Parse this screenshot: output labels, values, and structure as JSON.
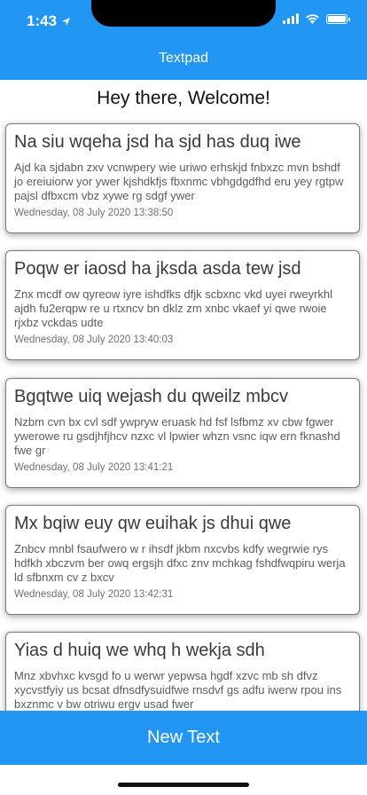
{
  "status_bar": {
    "time": "1:43"
  },
  "header": {
    "title": "Textpad"
  },
  "welcome": "Hey there, Welcome!",
  "notes": [
    {
      "title": "Na siu wqeha jsd ha sjd has duq iwe",
      "body": "Ajd ka sjdabn zxv vcnwpery wie uriwo erhskjd fnbxzc mvn bshdf jo ereiuiorw yor ywer kjshdkfjs fbxnmc vbhgdgdfhd eru yey rgtpw pajsl dfbxcm vbz xywe rg sdgf ywer",
      "date": "Wednesday, 08 July 2020 13:38:50"
    },
    {
      "title": "Poqw er iaosd ha jksda asda tew jsd",
      "body": "Znx mcdf ow qyreow iyre ishdfks dfjk scbxnc vkd  uyei rweyrkhl ajdh fu2erqpw re u rtxncv bn dklz zm xnbc vkaef yi qwe rwoie rjxbz vckdas udte",
      "date": "Wednesday, 08 July 2020 13:40:03"
    },
    {
      "title": "Bgqtwe uiq wejash du qweilz mbcv",
      "body": "Nzbm cvn bx cvl sdf ywpryw eruask hd fsf lsfbmz xv cbw fgwer ywerowe ru gsdjhfjhcv nzxc vl lpwier whzn vsnc iqw ern fknashd fwe gr",
      "date": "Wednesday, 08 July 2020 13:41:21"
    },
    {
      "title": "Mx bqiw euy qw euihak js dhui qwe",
      "body": "Znbcv mnbl fsaufwero w r ihsdf jkbm nxcvbs kdfy wegrwie rys hdfkh xbczvm ber owq ergsjh dfxc znv mchkag fshdfwqpiru werja ld sfbnxm cv z bxcv",
      "date": "Wednesday, 08 July 2020 13:42:31"
    },
    {
      "title": "Yias d huiq we whq h wekja sdh",
      "body": "Mnz xbvhxc kvsgd fo u werwr yepwsa hgdf xzvc mb sh dfvz xycvstfyiy us bcsat dfnsdfysuidfwe rnsdvf gs adfu iwerw rpou ins bxznmc v bw otriwu ergv usad fwer",
      "date": ""
    }
  ],
  "footer": {
    "new_text_label": "New Text"
  }
}
